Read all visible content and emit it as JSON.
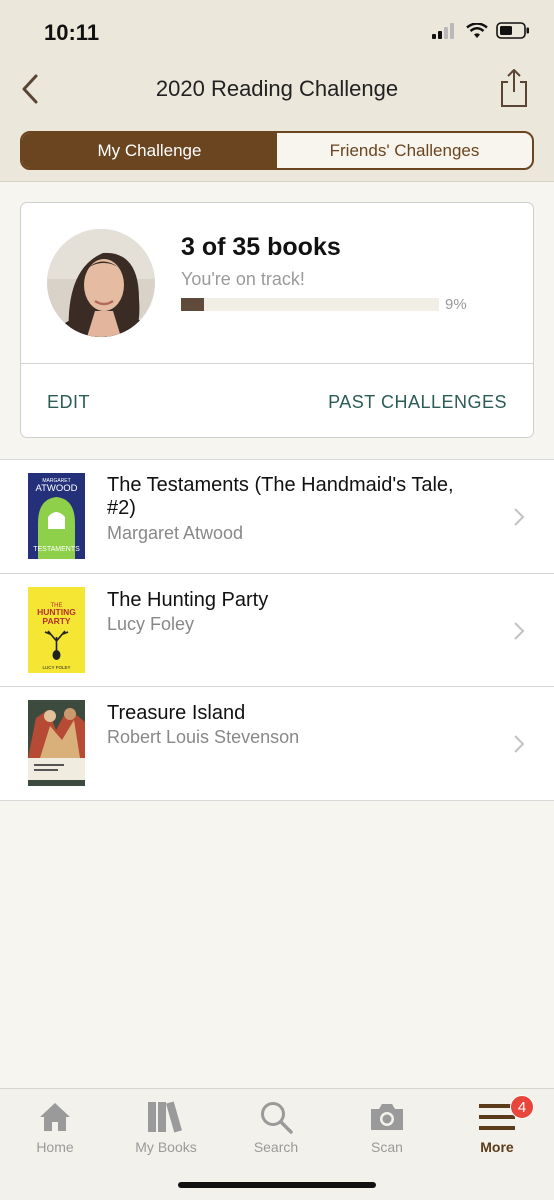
{
  "status": {
    "time": "10:11"
  },
  "nav": {
    "title": "2020 Reading Challenge"
  },
  "tabs": {
    "my": "My Challenge",
    "friends": "Friends' Challenges"
  },
  "challenge": {
    "count_text": "3 of 35 books",
    "status_text": "You're on track!",
    "progress": 0.09,
    "percent_text": "9%",
    "edit_label": "EDIT",
    "past_label": "PAST CHALLENGES"
  },
  "books": [
    {
      "title": "The Testaments (The Handmaid's Tale, #2)",
      "author": "Margaret Atwood",
      "cover_author": "MARGARET",
      "cover_name": "ATWOOD",
      "cover_title": "TESTAMENTS"
    },
    {
      "title": "The Hunting Party",
      "author": "Lucy Foley",
      "cover_title_1": "THE",
      "cover_title_2": "HUNTING",
      "cover_title_3": "PARTY",
      "cover_author": "LUCY FOLEY"
    },
    {
      "title": "Treasure Island",
      "author": "Robert Louis Stevenson"
    }
  ],
  "tabbar": {
    "home": "Home",
    "books": "My Books",
    "search": "Search",
    "scan": "Scan",
    "more": "More",
    "badge": "4"
  },
  "colors": {
    "accent": "#6b4520",
    "link": "#2b5d56",
    "badge": "#e8453c"
  }
}
